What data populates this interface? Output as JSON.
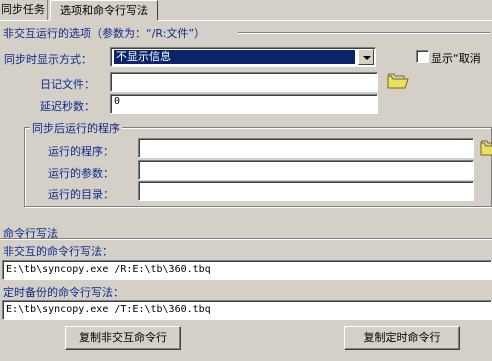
{
  "tabs": [
    {
      "label": "同步任务"
    },
    {
      "label": "选项和命令行写法"
    }
  ],
  "noninteractive": {
    "heading": "非交互运行的选项（参数为：“/R:文件”）",
    "display_mode_label": "同步时显示方式：",
    "display_mode_value": "不显示信息",
    "show_cancel_label": "显示“取消",
    "log_file_label": "日记文件：",
    "log_file_value": "",
    "delay_label": "延迟秒数：",
    "delay_value": "0"
  },
  "post_sync": {
    "group_title": "同步后运行的程序",
    "program_label": "运行的程序：",
    "program_value": "",
    "params_label": "运行的参数：",
    "params_value": "",
    "dir_label": "运行的目录：",
    "dir_value": ""
  },
  "cmdline": {
    "heading": "命令行写法",
    "noninteractive_label": "非交互的命令行写法：",
    "noninteractive_value": "E:\\tb\\syncopy.exe /R:E:\\tb\\360.tbq",
    "scheduled_label": "定时备份的命令行写法：",
    "scheduled_value": "E:\\tb\\syncopy.exe /T:E:\\tb\\360.tbq",
    "copy_noninteractive_button": "复制非交互命令行",
    "copy_scheduled_button": "复制定时命令行"
  },
  "colors": {
    "window_bg": "#d4d0c8",
    "selection_bg": "#0a246a",
    "heading_text": "#0b2a8c"
  }
}
